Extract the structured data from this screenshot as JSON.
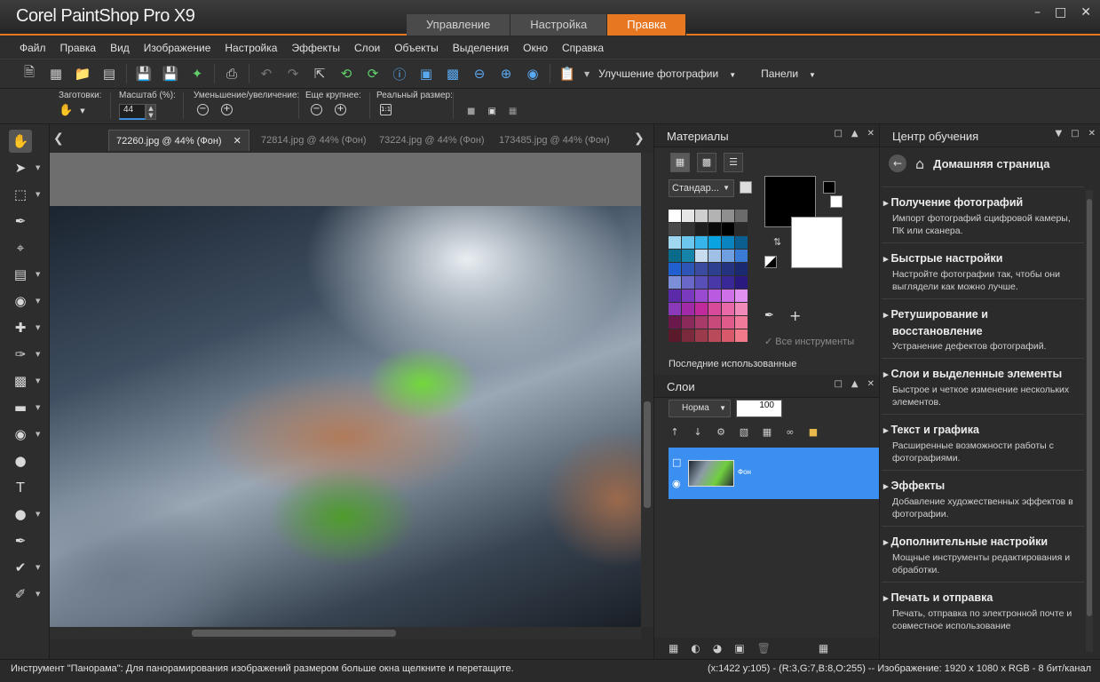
{
  "app": {
    "title": "Corel PaintShop Pro X9",
    "modes": [
      "Управление",
      "Настройка",
      "Правка"
    ],
    "active_mode": "Правка"
  },
  "menu": [
    "Файл",
    "Правка",
    "Вид",
    "Изображение",
    "Настройка",
    "Эффекты",
    "Слои",
    "Объекты",
    "Выделения",
    "Окно",
    "Справка"
  ],
  "toolbar": {
    "icons": [
      "new-file-icon",
      "grid-icon",
      "open-folder-icon",
      "scanner-icon",
      "save-icon",
      "save-as-icon",
      "share-icon",
      "print-icon",
      "undo-icon",
      "redo-icon",
      "resize-icon",
      "rotate-left-icon",
      "rotate-right-icon",
      "info-icon",
      "actual-size-icon",
      "fit-window-icon",
      "zoom-out-icon",
      "zoom-in-icon",
      "screenshot-icon",
      "clipboard-icon"
    ],
    "photo_fix": "Улучшение фотографии",
    "panels": "Панели"
  },
  "options": {
    "presets_label": "Заготовки:",
    "zoom_label": "Масштаб (%):",
    "zoom_value": "44",
    "zoom_inout_label": "Уменьшение/увеличение:",
    "more_label": "Еще крупнее:",
    "actual_label": "Реальный размер:"
  },
  "tools": [
    "pan-icon",
    "pick-icon",
    "selection-icon",
    "eyedropper-icon",
    "crop-icon",
    "straighten-icon",
    "red-eye-icon",
    "clone-icon",
    "paintbrush-icon",
    "gradient-icon",
    "eraser-icon",
    "fill-icon",
    "color-changer-icon",
    "text-icon",
    "shape-icon",
    "pen-icon",
    "retouch-icon",
    "smudge-icon"
  ],
  "documents": {
    "tabs": [
      "72260.jpg @  44% (Фон)",
      "72814.jpg @  44% (Фон)",
      "73224.jpg @  44% (Фон)",
      "173485.jpg @  44% (Фон)"
    ],
    "active_index": 0
  },
  "materials": {
    "title": "Материалы",
    "swatch_set": "Стандар...",
    "all_tools": "Все инструменты",
    "recent": "Последние использованные",
    "swatches": [
      "#ffffff",
      "#e6e6e6",
      "#cfcfcf",
      "#b3b3b3",
      "#8f8f8f",
      "#6b6b6b",
      "#4a4a4a",
      "#333333",
      "#1e1e1e",
      "#0a0a0a",
      "#000000",
      "#2a2a2a",
      "#9fd7f0",
      "#6cc6ee",
      "#36b5ea",
      "#0aa3e2",
      "#0a84c0",
      "#0a5f90",
      "#0a6a8a",
      "#1584a8",
      "#c8dcf0",
      "#a0c0e8",
      "#6f9fe0",
      "#3a7bd8",
      "#1f5fd0",
      "#2d55b8",
      "#3a4ba0",
      "#2d3f90",
      "#233380",
      "#1a2a70",
      "#7b8fd8",
      "#6a68c8",
      "#5850b8",
      "#4838a8",
      "#382898",
      "#2a1a80",
      "#5a2aa8",
      "#7a3ac0",
      "#9a4ad0",
      "#ba5ae0",
      "#d070e8",
      "#e090f0",
      "#8a3ab8",
      "#a02aa8",
      "#c02a9a",
      "#d84a9a",
      "#e86aa8",
      "#f08ab8",
      "#6a1a4a",
      "#8a2a5a",
      "#a83a6a",
      "#c84a7a",
      "#e05a8a",
      "#f07a9a",
      "#5a1a2a",
      "#7a2a3a",
      "#9a3a4a",
      "#b84a5a",
      "#d85a6a",
      "#f07a8a"
    ]
  },
  "layers": {
    "title": "Слои",
    "blend_mode": "Норма",
    "opacity": "100",
    "layer_name": "Фон"
  },
  "learning": {
    "title": "Центр обучения",
    "home": "Домашняя страница",
    "items": [
      {
        "title": "Получение фотографий",
        "desc": "Импорт фотографий сцифровой камеры, ПК или сканера."
      },
      {
        "title": "Быстрые настройки",
        "desc": "Настройте фотографии так, чтобы они выглядели как можно лучше."
      },
      {
        "title": "Ретуширование и восстановление",
        "desc": "Устранение дефектов фотографий."
      },
      {
        "title": "Слои и выделенные элементы",
        "desc": "Быстрое и четкое изменение нескольких элементов."
      },
      {
        "title": "Текст и графика",
        "desc": "Расширенные возможности работы с фотографиями."
      },
      {
        "title": "Эффекты",
        "desc": "Добавление художественных эффектов в фотографии."
      },
      {
        "title": "Дополнительные настройки",
        "desc": "Мощные инструменты редактирования и обработки."
      },
      {
        "title": "Печать и отправка",
        "desc": "Печать, отправка по электронной почте и совместное использование"
      }
    ]
  },
  "status": {
    "left": "Инструмент \"Панорама\": Для панорамирования изображений размером больше окна щелкните и перетащите.",
    "right": "(x:1422 y:105) - (R:3,G:7,B:8,O:255) -- Изображение:  1920 x 1080 x RGB - 8 бит/канал"
  }
}
